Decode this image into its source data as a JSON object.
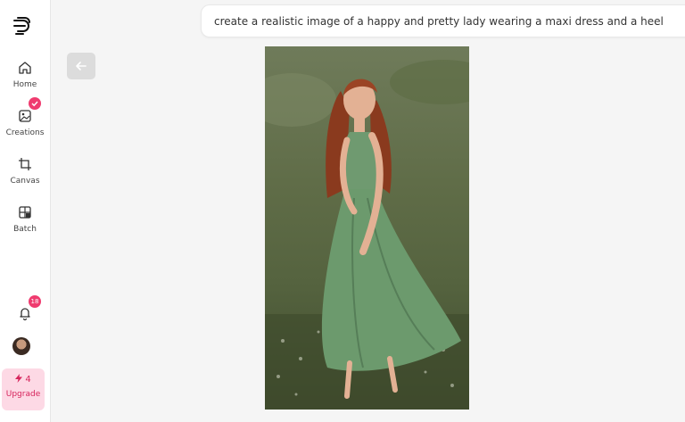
{
  "sidebar": {
    "items": [
      {
        "label": "Home",
        "icon": "home-icon"
      },
      {
        "label": "Creations",
        "icon": "image-icon"
      },
      {
        "label": "Canvas",
        "icon": "crop-icon"
      },
      {
        "label": "Batch",
        "icon": "grid-icon"
      }
    ],
    "notifications_count": "18",
    "upgrade": {
      "credits": "4",
      "label": "Upgrade"
    }
  },
  "prompt": {
    "text": "create a realistic image of a happy and pretty lady wearing a maxi dress and a heel"
  },
  "colors": {
    "accent": "#ef3b6f",
    "upgrade_bg": "#fdd9e5"
  }
}
